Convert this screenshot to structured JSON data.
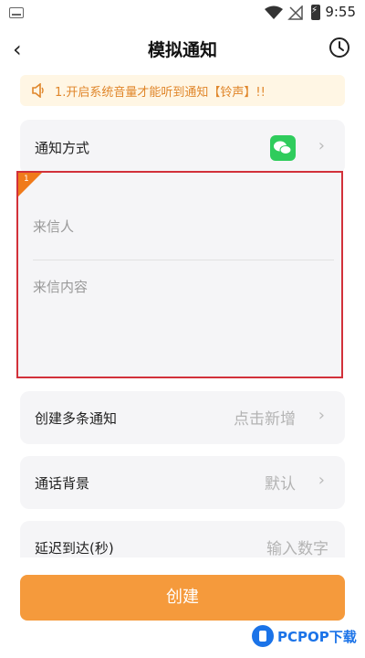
{
  "status_bar": {
    "time": "9:55",
    "icons": [
      "sim-icon",
      "wifi-icon",
      "no-signal-icon",
      "battery-charging-icon"
    ]
  },
  "header": {
    "title": "模拟通知",
    "back_icon": "back-chevron-icon",
    "history_icon": "clock-icon"
  },
  "notice": {
    "text": "1.开启系统音量才能听到通知【铃声】!!",
    "icon": "speaker-icon",
    "color": "#e0862a"
  },
  "notify_method": {
    "label": "通知方式",
    "icon": "wechat-icon"
  },
  "message": {
    "badge": "1",
    "sender_placeholder": "来信人",
    "content_placeholder": "来信内容"
  },
  "multi": {
    "label": "创建多条通知",
    "value": "点击新增"
  },
  "background": {
    "label": "通话背景",
    "value": "默认"
  },
  "delay": {
    "label": "延迟到达(秒)",
    "placeholder": "输入数字"
  },
  "create_button": {
    "label": "创建",
    "color": "#f59a3c"
  },
  "watermark": {
    "brand": "PCPOP下载"
  }
}
